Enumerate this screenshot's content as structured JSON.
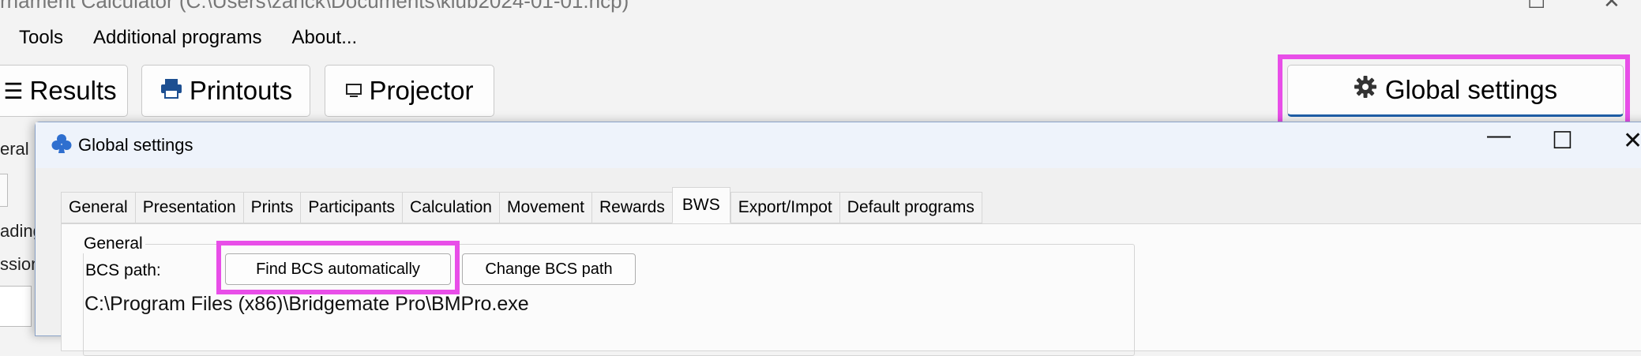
{
  "window": {
    "title": "rnament Calculator (C:\\Users\\zanck\\Documents\\klub2024-01-01.hcp)"
  },
  "menu": [
    "Tools",
    "Additional programs",
    "About..."
  ],
  "toolbar": {
    "results": "Results",
    "printouts": "Printouts",
    "projector": "Projector",
    "global_settings": "Global settings"
  },
  "background_peek": {
    "tab_fragment": "eral",
    "line1_fragment": "ading",
    "line2_fragment": "ssion"
  },
  "dialog": {
    "title": "Global settings",
    "tabs": [
      "General",
      "Presentation",
      "Prints",
      "Participants",
      "Calculation",
      "Movement",
      "Rewards",
      "BWS",
      "Export/Impot",
      "Default programs"
    ],
    "active_tab": "BWS",
    "group_title": "General",
    "bcs_path_label": "BCS path:",
    "find_bcs_button": "Find BCS automatically",
    "change_bcs_button": "Change BCS path",
    "bcs_path_value": "C:\\Program Files (x86)\\Bridgemate Pro\\BMPro.exe"
  },
  "colors": {
    "highlight": "#e84ee8",
    "accent": "#1f5fa8",
    "club_icon": "#2f6fcf"
  },
  "icons": [
    "gear-icon",
    "printer-icon",
    "monitor-icon",
    "club-icon",
    "minimize-icon",
    "maximize-icon",
    "close-icon"
  ]
}
